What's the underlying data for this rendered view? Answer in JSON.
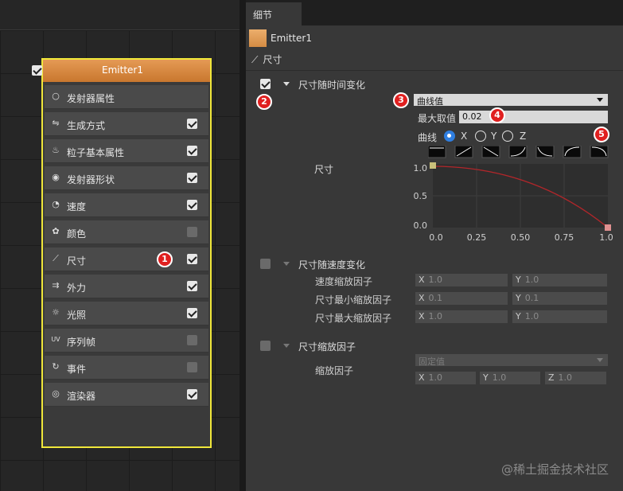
{
  "node": {
    "title": "Emitter1",
    "modules": [
      {
        "label": "发射器属性",
        "icon": "circle-icon",
        "glyph": "○",
        "checked": null
      },
      {
        "label": "生成方式",
        "icon": "sliders-icon",
        "glyph": "⇋",
        "checked": true
      },
      {
        "label": "粒子基本属性",
        "icon": "flame-icon",
        "glyph": "♨",
        "checked": true
      },
      {
        "label": "发射器形状",
        "icon": "location-pin-icon",
        "glyph": "◉",
        "checked": true
      },
      {
        "label": "速度",
        "icon": "speedometer-icon",
        "glyph": "◔",
        "checked": true
      },
      {
        "label": "颜色",
        "icon": "palette-icon",
        "glyph": "✿",
        "checked": false
      },
      {
        "label": "尺寸",
        "icon": "ruler-icon",
        "glyph": "⟋",
        "checked": true
      },
      {
        "label": "外力",
        "icon": "double-arrow-icon",
        "glyph": "⇉",
        "checked": true
      },
      {
        "label": "光照",
        "icon": "sun-icon",
        "glyph": "☼",
        "checked": true
      },
      {
        "label": "序列帧",
        "icon": "uv-icon",
        "glyph": "UV",
        "checked": false
      },
      {
        "label": "事件",
        "icon": "refresh-icon",
        "glyph": "↻",
        "checked": false
      },
      {
        "label": "渲染器",
        "icon": "render-icon",
        "glyph": "◎",
        "checked": true
      }
    ]
  },
  "badges": [
    "1",
    "2",
    "3",
    "4",
    "5"
  ],
  "details": {
    "tab": "细节",
    "emitter_name": "Emitter1",
    "size_header": "尺寸",
    "size_over_time": {
      "label": "尺寸随时间变化",
      "mode": "曲线值",
      "max_label": "最大取值",
      "max_value": "0.02",
      "curve_label": "曲线",
      "axes": [
        "X",
        "Y",
        "Z"
      ],
      "graph_label": "尺寸",
      "y_ticks": [
        "1.0",
        "0.5",
        "0.0"
      ],
      "x_ticks": [
        "0.0",
        "0.25",
        "0.50",
        "0.75",
        "1.0"
      ]
    },
    "size_by_speed": {
      "label": "尺寸随速度变化",
      "rows": [
        {
          "label": "速度缩放因子",
          "x": "1.0",
          "y": "1.0"
        },
        {
          "label": "尺寸最小缩放因子",
          "x": "0.1",
          "y": "0.1"
        },
        {
          "label": "尺寸最大缩放因子",
          "x": "1.0",
          "y": "1.0"
        }
      ]
    },
    "size_scale": {
      "label": "尺寸缩放因子",
      "mode": "固定值",
      "factor_label": "缩放因子",
      "x": "1.0",
      "y": "1.0",
      "z": "1.0"
    },
    "axis_x": "X",
    "axis_y": "Y",
    "axis_z": "Z"
  },
  "watermark": "@稀土掘金技术社区",
  "colors": {
    "accent": "#2f7ee0",
    "highlight": "#f0e73a",
    "curve": "#b3262a",
    "badge": "#e02020"
  }
}
